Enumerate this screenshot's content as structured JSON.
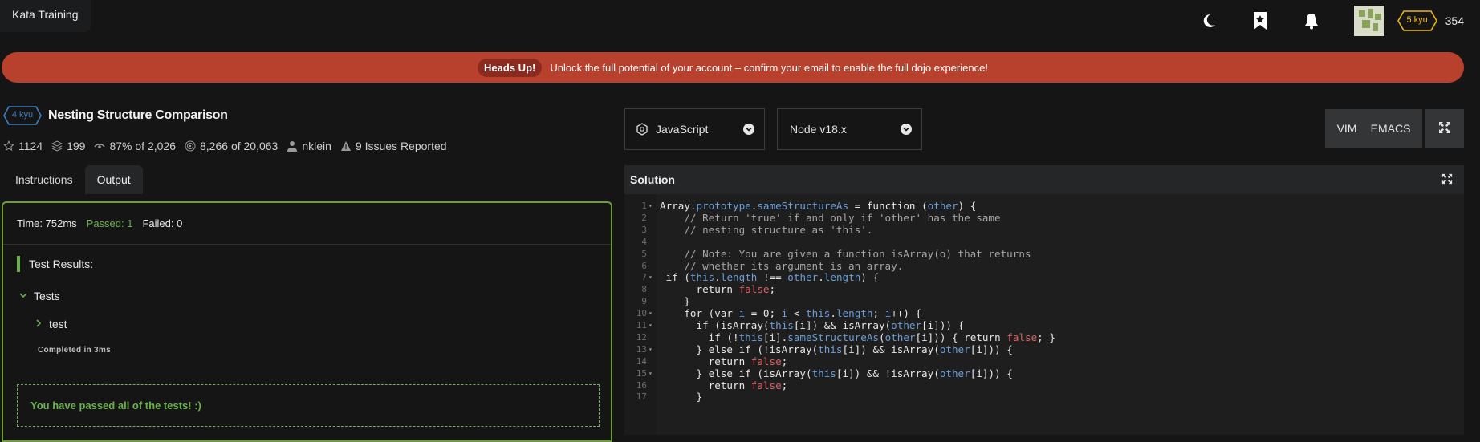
{
  "app": {
    "title": "Kata Training"
  },
  "header": {
    "rank": "5 kyu",
    "honor": "354",
    "colors": {
      "rank": "#ecb613"
    }
  },
  "banner": {
    "label": "Heads Up!",
    "message": "Unlock the full potential of your account – confirm your email to enable the full dojo experience!",
    "color": "#b8412d"
  },
  "kata": {
    "rank": "4 kyu",
    "name": "Nesting Structure Comparison",
    "stats": {
      "stars": "1124",
      "collections": "199",
      "satisfaction": "87%",
      "satisfaction_of": "of 2,026",
      "completed": "8,266",
      "completed_of": "of 20,063",
      "author": "nklein",
      "issues": "9 Issues Reported"
    }
  },
  "tabs": [
    {
      "label": "Instructions",
      "active": false
    },
    {
      "label": "Output",
      "active": true
    }
  ],
  "output": {
    "time": "Time: 752ms",
    "passed": "Passed: 1",
    "failed": "Failed: 0",
    "results_title": "Test Results:",
    "group": "Tests",
    "test": "test",
    "completed": "Completed in 3ms",
    "pass_message": "You have passed all of the tests! :)",
    "colors": {
      "pass": "#6ab04c"
    }
  },
  "editor_controls": {
    "language": "JavaScript",
    "runtime": "Node v18.x",
    "mode_vim": "VIM",
    "mode_emacs": "EMACS"
  },
  "solution": {
    "title": "Solution",
    "lines": [
      {
        "n": "1",
        "fold": true
      },
      {
        "n": "2",
        "fold": false
      },
      {
        "n": "3",
        "fold": false
      },
      {
        "n": "4",
        "fold": false
      },
      {
        "n": "5",
        "fold": false
      },
      {
        "n": "6",
        "fold": false
      },
      {
        "n": "7",
        "fold": true
      },
      {
        "n": "8",
        "fold": false
      },
      {
        "n": "9",
        "fold": false
      },
      {
        "n": "10",
        "fold": true
      },
      {
        "n": "11",
        "fold": true
      },
      {
        "n": "12",
        "fold": false
      },
      {
        "n": "13",
        "fold": true
      },
      {
        "n": "14",
        "fold": false
      },
      {
        "n": "15",
        "fold": true
      },
      {
        "n": "16",
        "fold": false
      },
      {
        "n": "17",
        "fold": false
      }
    ],
    "code": [
      [
        [
          "k",
          "Array."
        ],
        [
          "b",
          "prototype"
        ],
        [
          "k",
          "."
        ],
        [
          "b",
          "sameStructureAs"
        ],
        [
          "k",
          " = function ("
        ],
        [
          "b",
          "other"
        ],
        [
          "k",
          ") {"
        ]
      ],
      [
        [
          "c",
          "    // Return 'true' if and only if 'other' has the same"
        ]
      ],
      [
        [
          "c",
          "    // nesting structure as 'this'."
        ]
      ],
      [],
      [
        [
          "c",
          "    // Note: You are given a function isArray(o) that returns"
        ]
      ],
      [
        [
          "c",
          "    // whether its argument is an array."
        ]
      ],
      [
        [
          "k",
          " if ("
        ],
        [
          "b",
          "this"
        ],
        [
          "k",
          "."
        ],
        [
          "b",
          "length"
        ],
        [
          "k",
          " !== "
        ],
        [
          "b",
          "other"
        ],
        [
          "k",
          "."
        ],
        [
          "b",
          "length"
        ],
        [
          "k",
          ") {"
        ]
      ],
      [
        [
          "k",
          "      return "
        ],
        [
          "r",
          "false"
        ],
        [
          "k",
          ";"
        ]
      ],
      [
        [
          "k",
          "    }"
        ]
      ],
      [
        [
          "k",
          "    for (var "
        ],
        [
          "b",
          "i"
        ],
        [
          "k",
          " = 0; "
        ],
        [
          "b",
          "i"
        ],
        [
          "k",
          " < "
        ],
        [
          "b",
          "this"
        ],
        [
          "k",
          "."
        ],
        [
          "b",
          "length"
        ],
        [
          "k",
          "; "
        ],
        [
          "b",
          "i"
        ],
        [
          "k",
          "++) {"
        ]
      ],
      [
        [
          "k",
          "      if (isArray("
        ],
        [
          "b",
          "this"
        ],
        [
          "k",
          "[i]) && isArray("
        ],
        [
          "b",
          "other"
        ],
        [
          "k",
          "[i])) {"
        ]
      ],
      [
        [
          "k",
          "        if (!"
        ],
        [
          "b",
          "this"
        ],
        [
          "k",
          "[i]."
        ],
        [
          "b",
          "sameStructureAs"
        ],
        [
          "k",
          "("
        ],
        [
          "b",
          "other"
        ],
        [
          "k",
          "[i])) { return "
        ],
        [
          "r",
          "false"
        ],
        [
          "k",
          "; }"
        ]
      ],
      [
        [
          "k",
          "      } else if (!isArray("
        ],
        [
          "b",
          "this"
        ],
        [
          "k",
          "[i]) && isArray("
        ],
        [
          "b",
          "other"
        ],
        [
          "k",
          "[i])) {"
        ]
      ],
      [
        [
          "k",
          "        return "
        ],
        [
          "r",
          "false"
        ],
        [
          "k",
          ";"
        ]
      ],
      [
        [
          "k",
          "      } else if (isArray("
        ],
        [
          "b",
          "this"
        ],
        [
          "k",
          "[i]) && !isArray("
        ],
        [
          "b",
          "other"
        ],
        [
          "k",
          "[i])) {"
        ]
      ],
      [
        [
          "k",
          "        return "
        ],
        [
          "r",
          "false"
        ],
        [
          "k",
          ";"
        ]
      ],
      [
        [
          "k",
          "      }"
        ]
      ]
    ]
  }
}
